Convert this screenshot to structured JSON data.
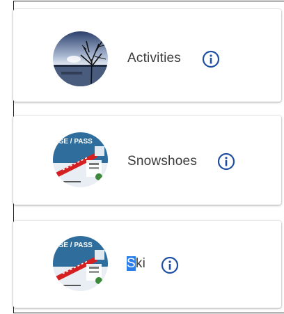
{
  "items": [
    {
      "label": "Activities",
      "icon": "info-icon",
      "image": "lake-tree-thumbnail"
    },
    {
      "label_first": "S",
      "label": "Snowshoes",
      "icon": "info-icon",
      "image": "pass-poster-thumbnail"
    },
    {
      "label_first": "S",
      "label_rest": "ki",
      "icon": "info-icon",
      "image": "pass-poster-thumbnail"
    }
  ],
  "colors": {
    "info_icon": "#1e4fa3",
    "selection": "#2b7de9",
    "label": "#3a3a3a"
  },
  "poster_text": "SSE / PASS"
}
